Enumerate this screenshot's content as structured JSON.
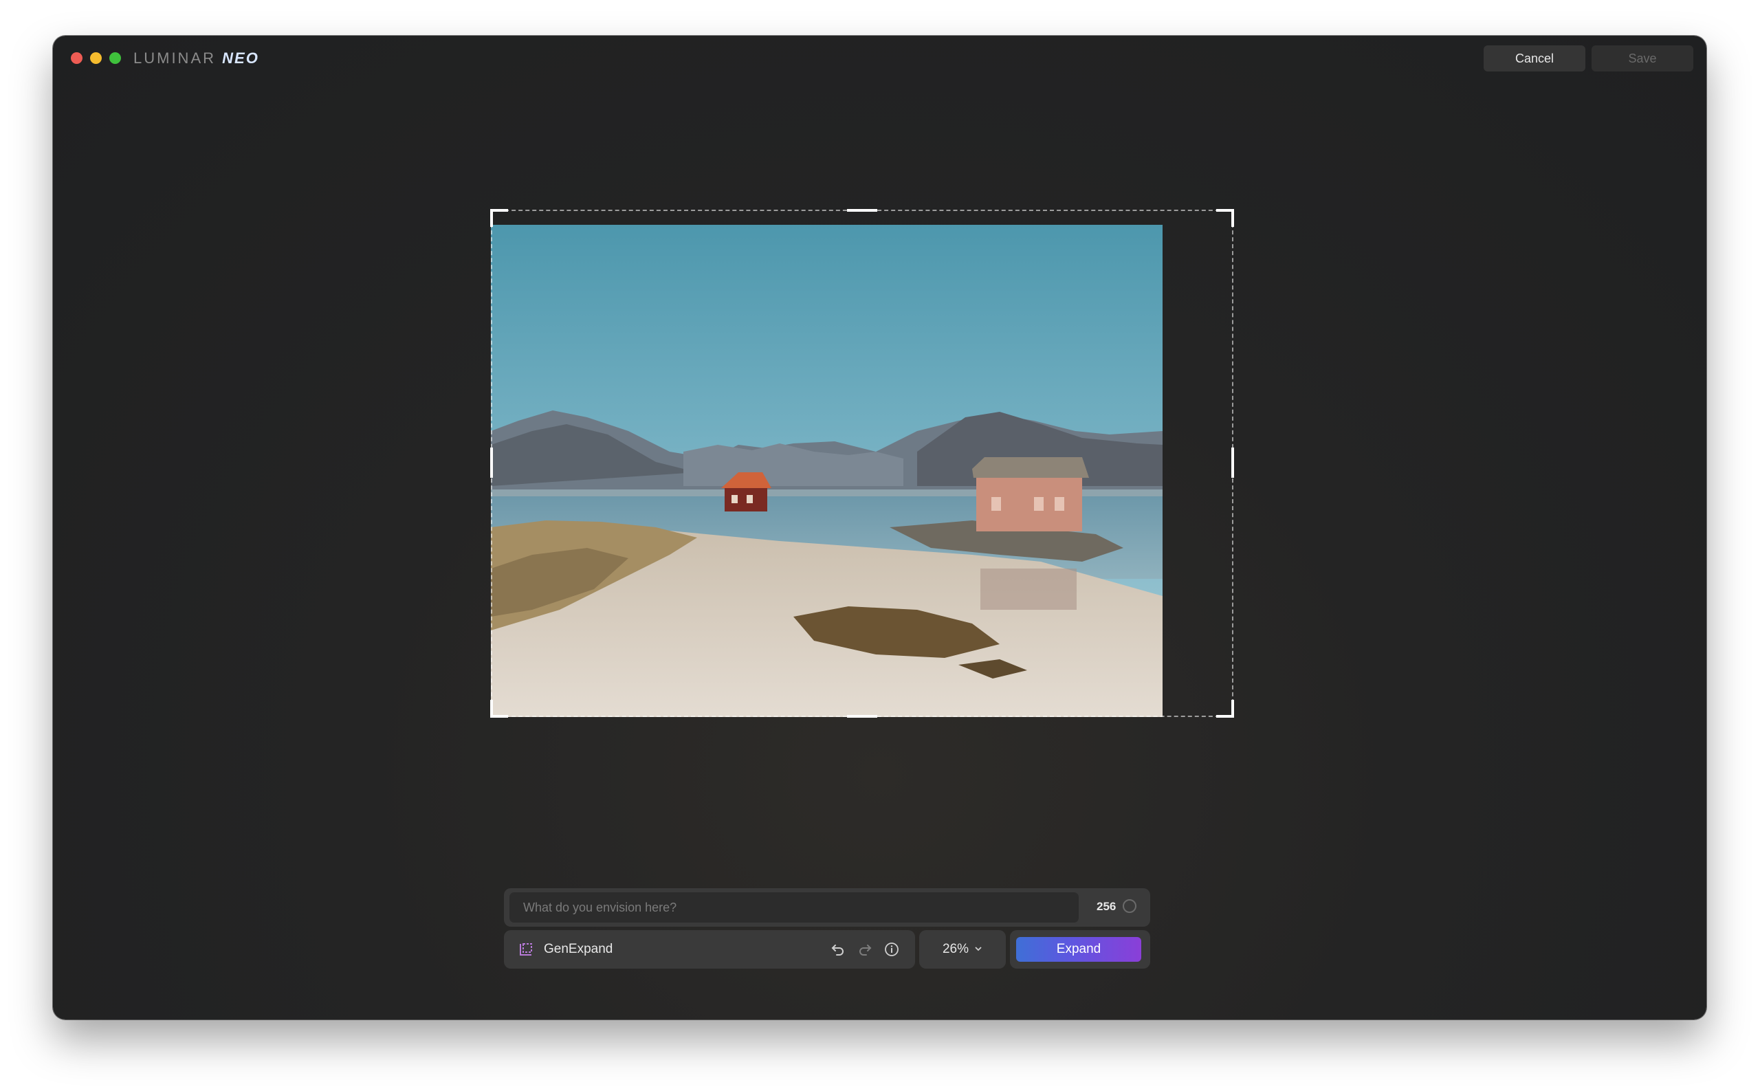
{
  "app": {
    "brand_main": "LUMINAR",
    "brand_accent": "NEO"
  },
  "header": {
    "cancel_label": "Cancel",
    "save_label": "Save"
  },
  "canvas": {
    "image_description": "landscape-photo-coastal-cabins"
  },
  "prompt": {
    "placeholder": "What do you envision here?",
    "value": "",
    "char_count": "256"
  },
  "toolbar": {
    "tool_name": "GenExpand",
    "tool_icon": "expand-crop-icon",
    "undo_icon": "undo-icon",
    "redo_icon": "redo-icon",
    "info_icon": "info-icon",
    "zoom_value": "26%",
    "expand_label": "Expand"
  },
  "colors": {
    "accent_gradient_start": "#3f6fd6",
    "accent_gradient_end": "#8a3fd8",
    "traffic_red": "#ee5c54",
    "traffic_yellow": "#f5bb2e",
    "traffic_green": "#3fc13c"
  }
}
